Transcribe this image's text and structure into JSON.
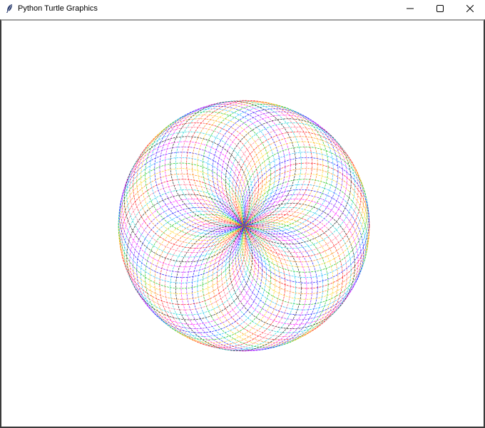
{
  "window": {
    "title": "Python Turtle Graphics",
    "icon": "feather-icon",
    "controls": [
      "minimize-icon",
      "maximize-icon",
      "close-icon"
    ]
  },
  "canvas": {
    "background": "#ffffff",
    "drawing": {
      "shape": "spirograph",
      "palette": [
        "#ff0000",
        "#ff7f00",
        "#ffd000",
        "#00c000",
        "#00b0ff",
        "#0000ff",
        "#8000ff",
        "#ff00ff",
        "#000000",
        "#00d0d0",
        "#ff6080"
      ]
    }
  }
}
